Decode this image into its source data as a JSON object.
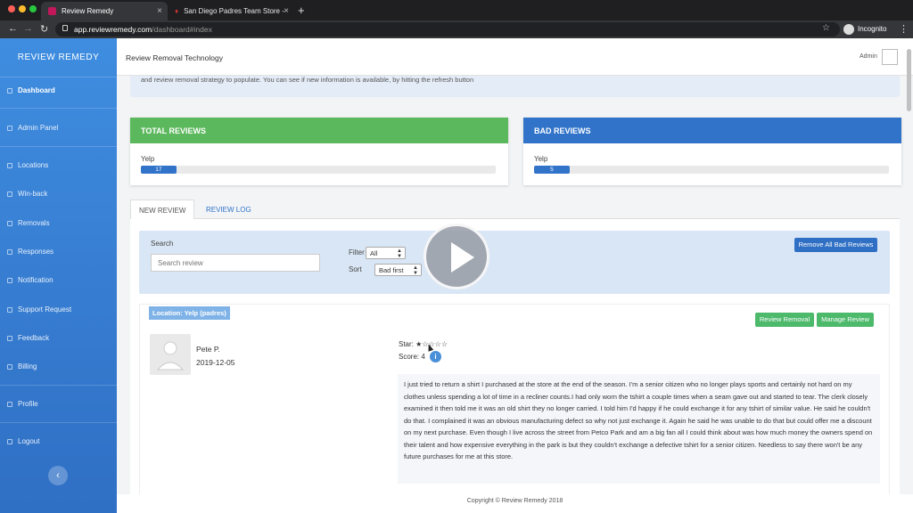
{
  "browser": {
    "tabs": [
      {
        "title": "Review Remedy",
        "active": true
      },
      {
        "title": "San Diego Padres Team Store -",
        "active": false
      }
    ],
    "url_host": "app.reviewremedy.com",
    "url_path": "/dashboard#index",
    "profile_label": "Incognito"
  },
  "sidebar": {
    "brand": "REVIEW REMEDY",
    "items": [
      {
        "label": "Dashboard",
        "icon": "dashboard-icon",
        "active": true
      },
      {
        "label": "Admin Panel",
        "icon": "grid-icon"
      },
      {
        "label": "Locations",
        "icon": "pin-icon"
      },
      {
        "label": "Win-back",
        "icon": "trophy-icon"
      },
      {
        "label": "Removals",
        "icon": "removals-icon"
      },
      {
        "label": "Responses",
        "icon": "responses-icon"
      },
      {
        "label": "Notification",
        "icon": "bell-icon"
      },
      {
        "label": "Support Request",
        "icon": "support-icon"
      },
      {
        "label": "Feedback",
        "icon": "feedback-icon"
      },
      {
        "label": "Billing",
        "icon": "billing-icon"
      },
      {
        "label": "Profile",
        "icon": "profile-icon"
      },
      {
        "label": "Logout",
        "icon": "logout-icon"
      }
    ],
    "collapse_glyph": "‹"
  },
  "header": {
    "title": "Review Removal Technology",
    "user_label": "Admin"
  },
  "notice": {
    "text": "and review removal strategy to populate. You can see if new information is available, by hitting the refresh button"
  },
  "cards": {
    "total": {
      "title": "TOTAL REVIEWS",
      "source": "Yelp",
      "count": "17",
      "fraction": 0.1,
      "color": "#5cb85c"
    },
    "bad": {
      "title": "BAD REVIEWS",
      "source": "Yelp",
      "count": "5",
      "fraction": 0.1,
      "color": "#3173c9"
    }
  },
  "review_tabs": [
    {
      "label": "NEW REVIEW",
      "active": true
    },
    {
      "label": "REVIEW LOG",
      "active": false
    }
  ],
  "filters": {
    "search_label": "Search",
    "search_placeholder": "Search review",
    "filter_label": "Filter",
    "filter_value": "All",
    "sort_label": "Sort",
    "sort_value": "Bad first",
    "remove_all_label": "Remove All Bad Reviews"
  },
  "review": {
    "location": "Location: Yelp (padres)",
    "removal_label": "Review Removal",
    "manage_label": "Manage Review",
    "reviewer": "Pete P.",
    "date": "2019-12-05",
    "star_label": "Star:",
    "stars": "★☆☆☆☆",
    "rating": 1,
    "score_label": "Score: 4",
    "info_glyph": "i",
    "text": "I just tried to return a shirt I purchased at the store at the end of the season. I'm a senior citizen who no longer plays sports and certainly not hard on my clothes unless spending a lot of time in a recliner counts.I had only worn the tshirt a couple times when a seam gave out and started to tear. The clerk closely examined it then told me it was an old shirt they no longer carried. I told him I'd happy if he could exchange it for any tshirt of similar value. He said he couldn't do that. I complained it was an obvious manufacturing defect so why not just exchange it. Again he said he was unable to do that but could offer me a discount on my next purchase. Even though I live across the street from Petco Park and am a big fan all I could think about was how much money the owners spend on their talent and how expensive everything in the park is but they couldn't exchange a defective tshirt for a senior citizen. Needless to say there won't be any future purchases for me at this store."
  },
  "footer": {
    "text": "Copyright © Review Remedy 2018"
  }
}
